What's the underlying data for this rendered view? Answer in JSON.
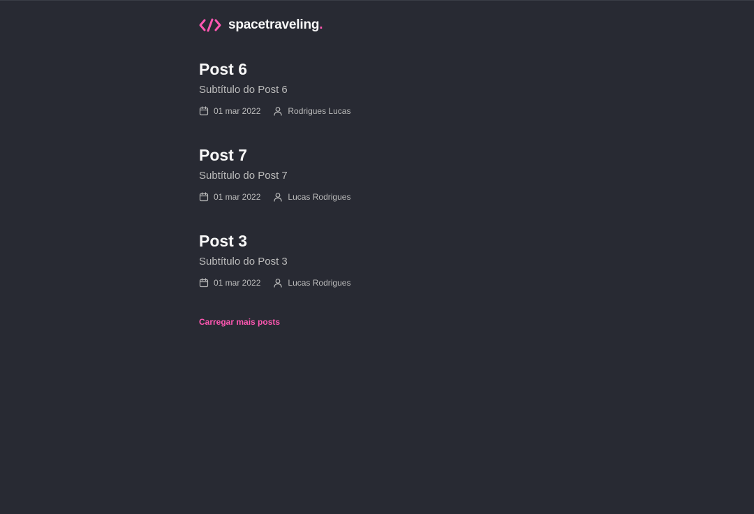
{
  "header": {
    "logo_text": "spacetraveling",
    "logo_dot": "."
  },
  "colors": {
    "background": "#282a33",
    "accent": "#ff57b2",
    "heading": "#f8f8f8",
    "body_text": "#bbbbbb"
  },
  "posts": [
    {
      "title": "Post 6",
      "subtitle": "Subtítulo do Post 6",
      "date": "01 mar 2022",
      "author": "Rodrigues Lucas",
      "date_icon": "calendar-icon",
      "author_icon": "user-icon"
    },
    {
      "title": "Post 7",
      "subtitle": "Subtítulo do Post 7",
      "date": "01 mar 2022",
      "author": "Lucas Rodrigues",
      "date_icon": "calendar-icon",
      "author_icon": "user-icon"
    },
    {
      "title": "Post 3",
      "subtitle": "Subtítulo do Post 3",
      "date": "01 mar 2022",
      "author": "Lucas Rodrigues",
      "date_icon": "calendar-icon",
      "author_icon": "user-icon"
    }
  ],
  "load_more_label": "Carregar mais posts"
}
